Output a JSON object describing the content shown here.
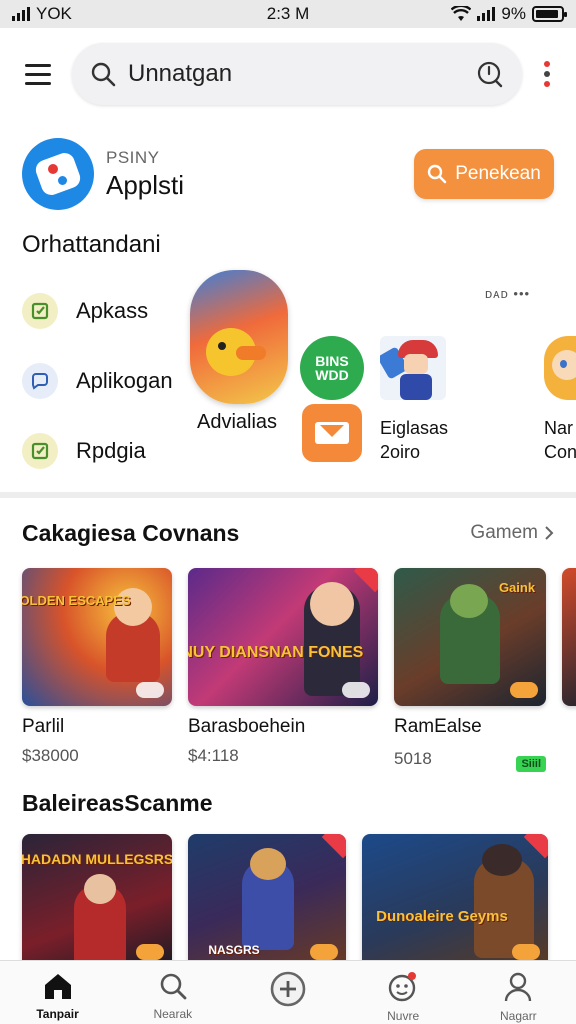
{
  "status_bar": {
    "carrier": "YOK",
    "time": "2:3 M",
    "battery": "9%",
    "battery_level": 0.9
  },
  "header": {
    "search_text": "Unnatgan"
  },
  "app": {
    "subtitle": "PSINY",
    "name": "Applsti",
    "action_label": "Penekean"
  },
  "section_label": "Orhattandani",
  "categories": [
    {
      "label": "Apkass",
      "icon": "square-check-icon",
      "color": "#f2efc4"
    },
    {
      "label": "Aplikogan",
      "icon": "chat-bubble-icon",
      "color": "#e6ecf8"
    },
    {
      "label": "Rpdgia",
      "icon": "square-check-icon",
      "color": "#f2efc4"
    }
  ],
  "featured": {
    "main_label": "Advialias",
    "green_badge_text": "BINS WDD",
    "hero_label_1": "Eiglasas",
    "hero_label_2": "2oiro",
    "edge_label_1": "Nar",
    "edge_label_2": "Con",
    "more_text": "ᴅᴀᴅ •••"
  },
  "section1": {
    "title": "Cakagiesa Covnans",
    "link": "Gamem",
    "cards": [
      {
        "name": "Parlil",
        "price": "$38000",
        "title_art": "GOLDEN ESCAPES"
      },
      {
        "name": "Barasboehein",
        "price": "$4:118",
        "title_art": "HRDNUY DIANSNAN FONES"
      },
      {
        "name": "RamEalse",
        "price": "5018",
        "title_art": "Gaink",
        "chip": "Siiil"
      }
    ]
  },
  "section2": {
    "title": "BaleireasScanme",
    "cards": [
      {
        "title_art": "HADADN MULLEGSRS"
      },
      {
        "title_art": "NASGRS"
      },
      {
        "title_art": "Dunoaleire Geyms"
      }
    ]
  },
  "bottom_nav": [
    {
      "label": "Tanpair",
      "icon": "home-icon",
      "active": true
    },
    {
      "label": "Nearak",
      "icon": "search-icon",
      "active": false
    },
    {
      "label": "",
      "icon": "add-circle-icon",
      "active": false
    },
    {
      "label": "Nuvre",
      "icon": "smiley-icon",
      "active": false
    },
    {
      "label": "Nagarr",
      "icon": "user-icon",
      "active": false
    }
  ],
  "colors": {
    "accent_orange": "#f4913f",
    "brand_blue": "#1e88e5",
    "green": "#2eaa4f",
    "alert_red": "#e53935"
  }
}
